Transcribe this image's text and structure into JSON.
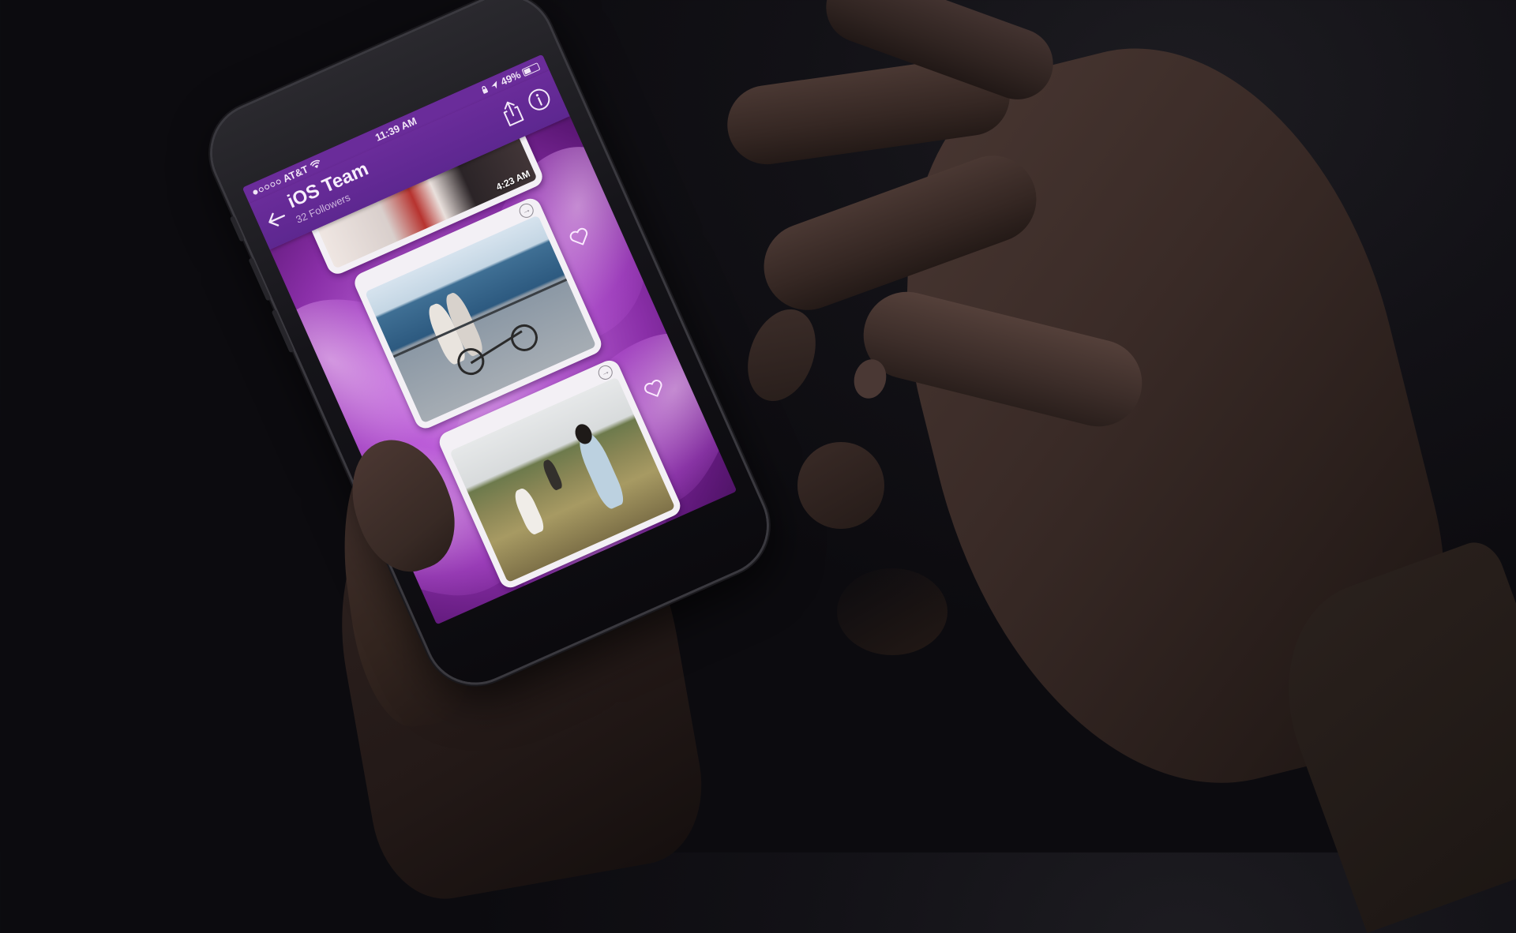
{
  "status_bar": {
    "carrier": "AT&T",
    "time": "11:39 AM",
    "battery": "49%",
    "battery_level": 0.49,
    "signal_bars_filled": 1,
    "signal_bars_total": 5
  },
  "nav": {
    "title": "iOS Team",
    "subtitle": "32 Followers"
  },
  "icons": {
    "back": "back-arrow-icon",
    "share": "share-icon",
    "info": "info-icon",
    "forward": "forward-arrow-icon",
    "like": "heart-icon",
    "wifi": "wifi-icon",
    "location": "location-arrow-icon"
  },
  "feed": {
    "items": [
      {
        "timestamp": "4:23 AM",
        "photo": "people-in-suits-photo"
      },
      {
        "timestamp": "",
        "photo": "couple-on-bicycle-by-sea-photo"
      },
      {
        "timestamp": "",
        "photo": "people-in-grass-field-photo"
      }
    ]
  },
  "colors": {
    "nav_bar": "#6a2c9a",
    "background_flower": "#b75fd2",
    "card": "#f3f0f5"
  }
}
